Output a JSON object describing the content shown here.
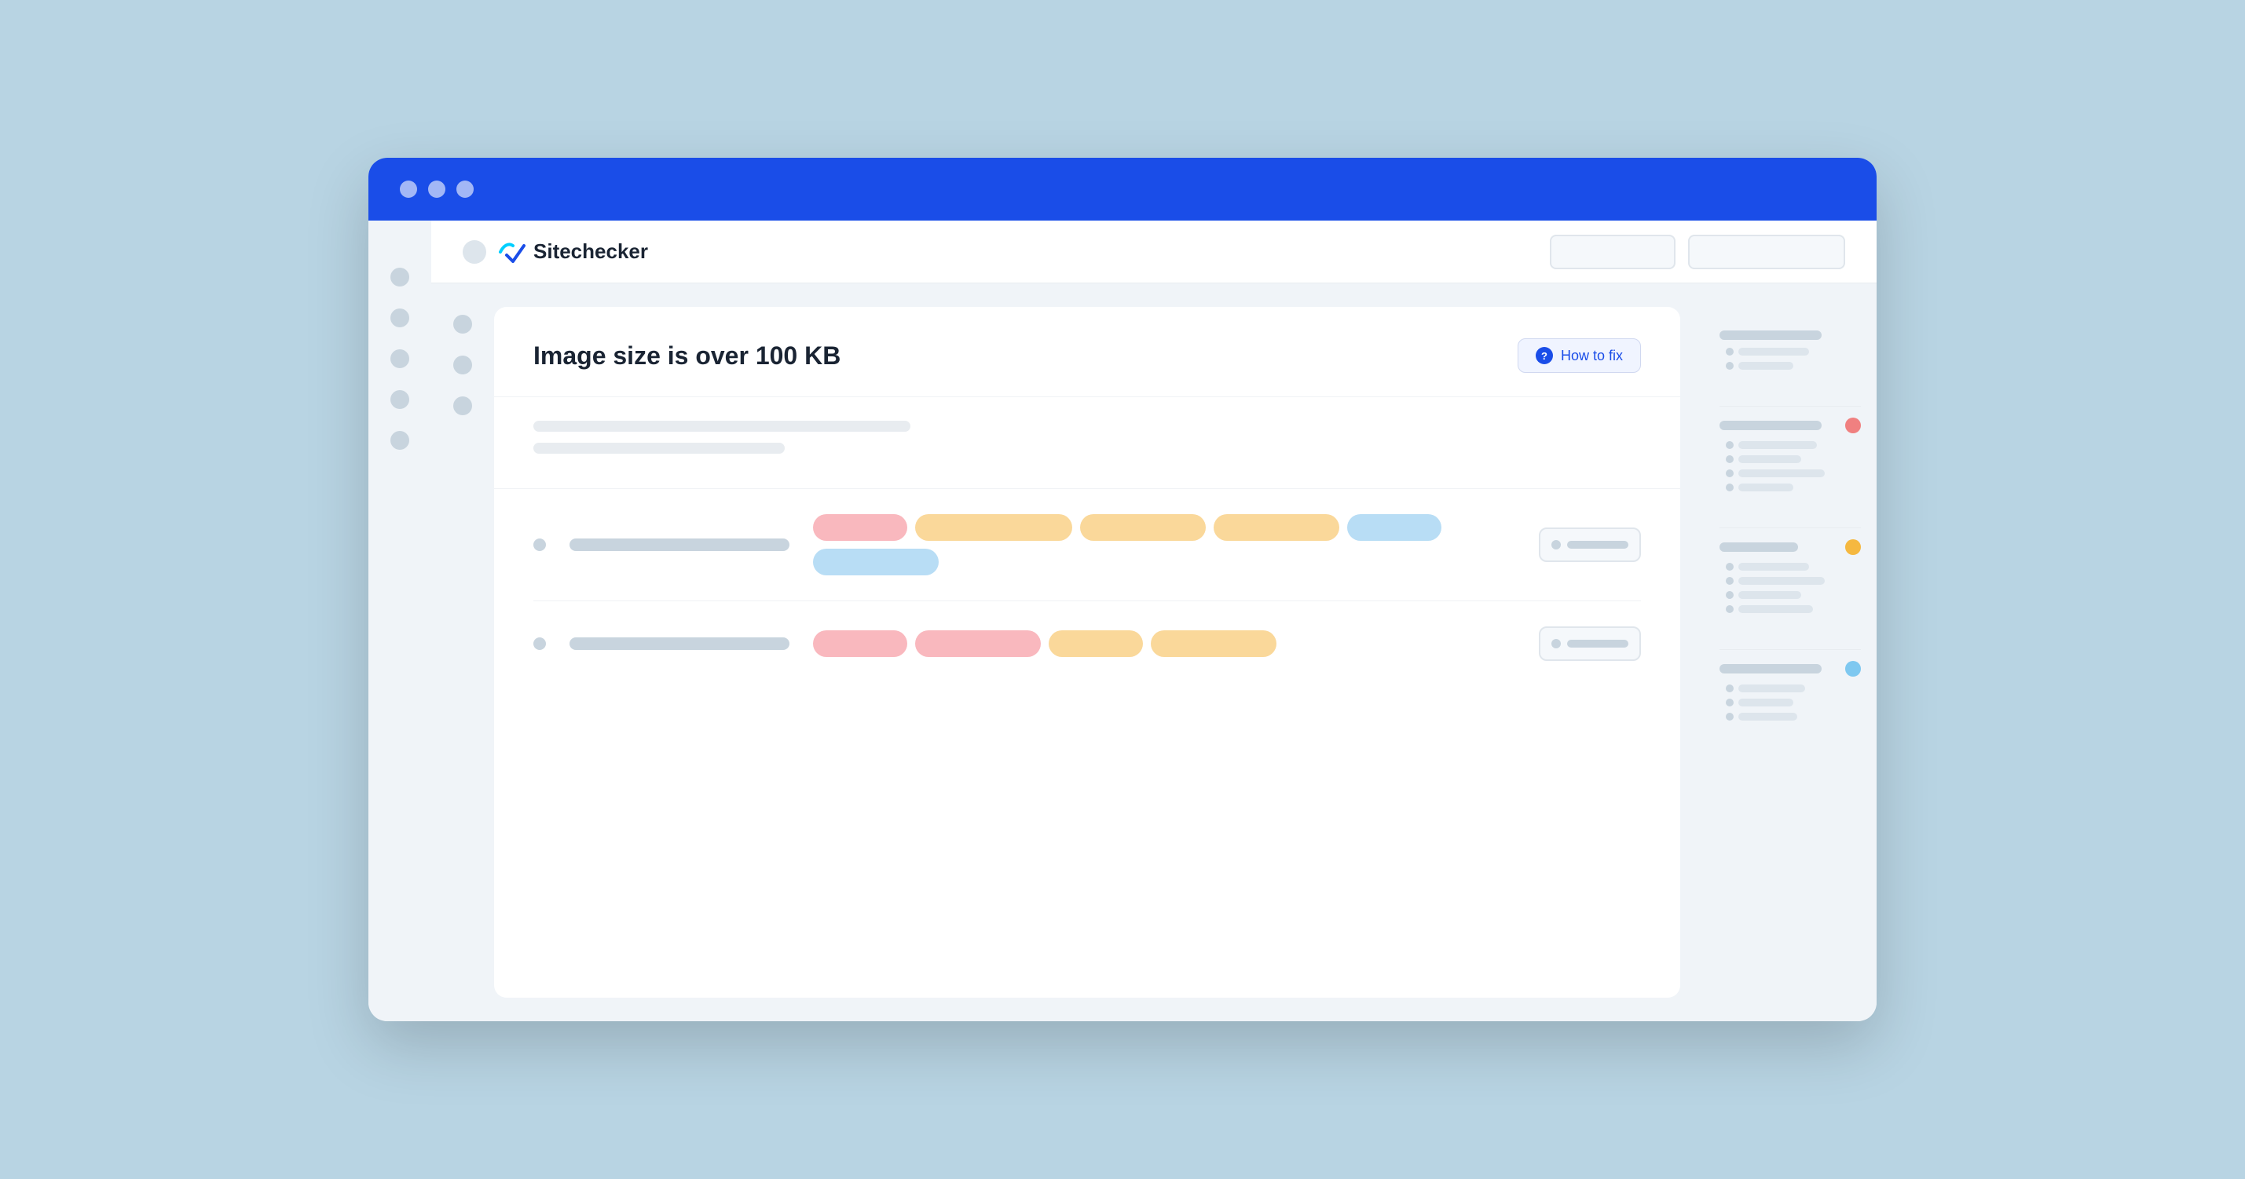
{
  "browser": {
    "title": "Sitechecker",
    "traffic_lights": [
      "close",
      "minimize",
      "maximize"
    ]
  },
  "header": {
    "logo_text": "Sitechecker",
    "button_primary": "",
    "button_secondary": ""
  },
  "issue": {
    "title": "Image size is over 100 KB",
    "how_to_fix_label": "How to fix"
  },
  "description": {
    "lines": [
      "long",
      "medium"
    ]
  },
  "table": {
    "rows": [
      {
        "tags_row1": [
          "pink-sm",
          "orange-lg"
        ],
        "tags_row2": [
          "orange-md",
          "orange-md",
          "blue-sm"
        ],
        "tags_row3": [
          "blue-md"
        ]
      },
      {
        "tags_row1": [
          "pink-sm",
          "pink-md"
        ],
        "tags_row2": [
          "orange-sm",
          "orange-md"
        ]
      }
    ]
  },
  "right_sidebar": {
    "groups": [
      {
        "main_line": "long",
        "dot": "none",
        "sub_lines": [
          "medium",
          "short",
          "medium"
        ]
      },
      {
        "main_line": "long",
        "dot": "red",
        "sub_lines": [
          "medium",
          "short",
          "medium",
          "short"
        ]
      },
      {
        "main_line": "long",
        "dot": "orange",
        "sub_lines": [
          "medium",
          "short",
          "medium",
          "medium"
        ]
      },
      {
        "main_line": "long",
        "dot": "blue",
        "sub_lines": [
          "medium",
          "short",
          "short"
        ]
      }
    ]
  }
}
